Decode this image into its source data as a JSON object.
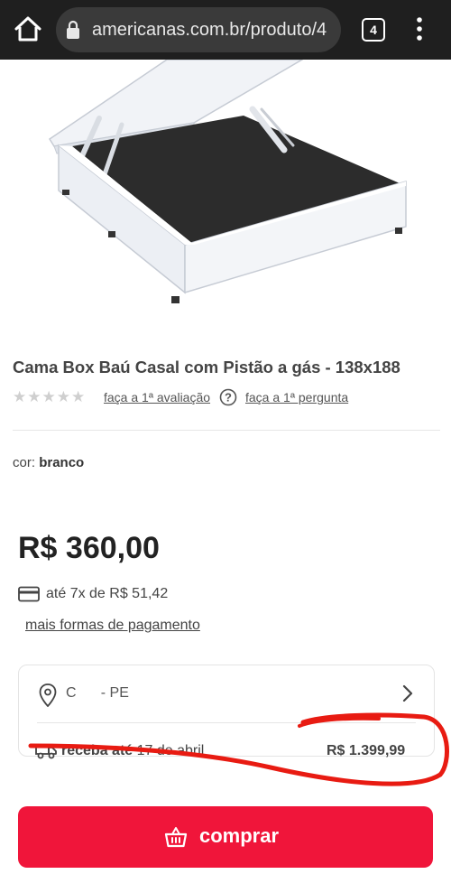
{
  "browser": {
    "url": "americanas.com.br/produto/4",
    "tab_count": "4",
    "icons": [
      "home-icon",
      "lock-icon",
      "tabs-icon",
      "kebab-menu-icon"
    ]
  },
  "product": {
    "title": "Cama Box Baú Casal com Pistão a gás - 138x188",
    "rating_link": "faça a 1ª avaliação",
    "question_link": "faça a 1ª pergunta",
    "color_label": "cor:",
    "color_value": "branco",
    "price": "R$ 360,00",
    "installments": "até 7x de R$ 51,42",
    "more_payment": "mais formas de pagamento"
  },
  "shipping": {
    "location": "C       - PE",
    "delivery_label": "receba até",
    "delivery_date": "17 de abril",
    "price": "R$ 1.399,99"
  },
  "buy_button": {
    "label": "comprar"
  },
  "colors": {
    "brand": "#f0153a",
    "annotation": "#e81b12"
  }
}
